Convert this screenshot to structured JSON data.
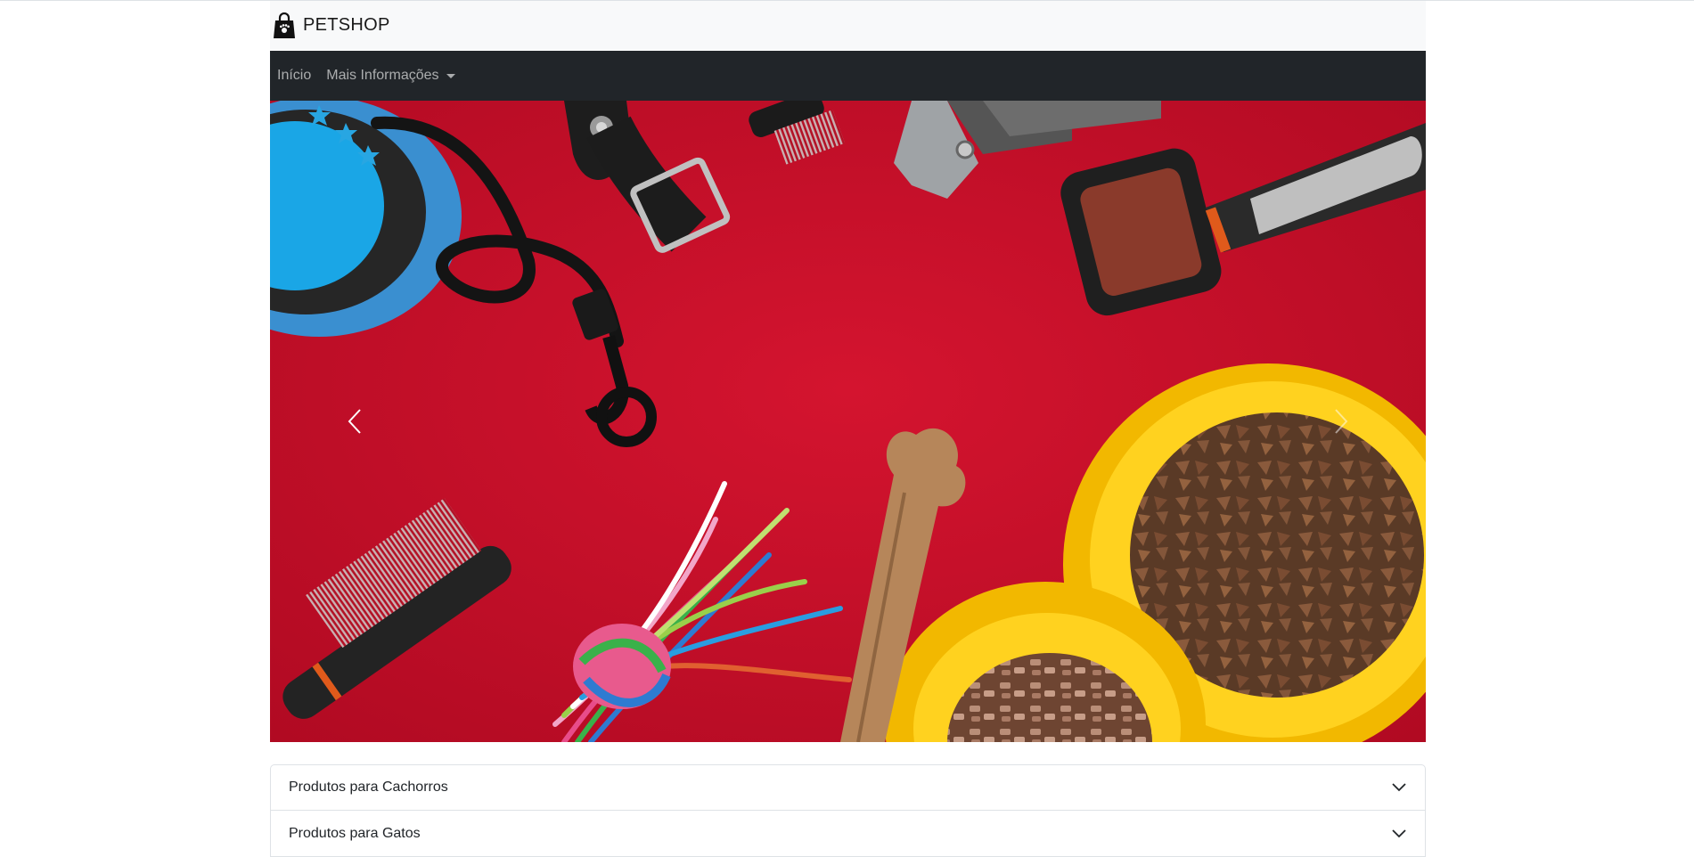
{
  "brand": {
    "name": "PETSHOP",
    "icon": "shopping-bag-paw-icon"
  },
  "nav": {
    "items": [
      {
        "label": "Início"
      },
      {
        "label": "Mais Informações",
        "dropdown": true
      }
    ]
  },
  "carousel": {
    "image_description": "Pet accessories on red background: leash, collar, combs, nail clipper, brush, rope toy, chew bone, yellow double bowl with pet food",
    "prev_icon": "chevron-left-icon",
    "next_icon": "chevron-right-icon"
  },
  "accordion": {
    "items": [
      {
        "label": "Produtos para Cachorros"
      },
      {
        "label": "Produtos para Gatos"
      }
    ],
    "chevron_icon": "chevron-down-icon"
  },
  "colors": {
    "brandbar_bg": "#f8f9fa",
    "navbar_bg": "#212529",
    "photo_bg": "#c8102e",
    "bowl": "#f5c400"
  }
}
